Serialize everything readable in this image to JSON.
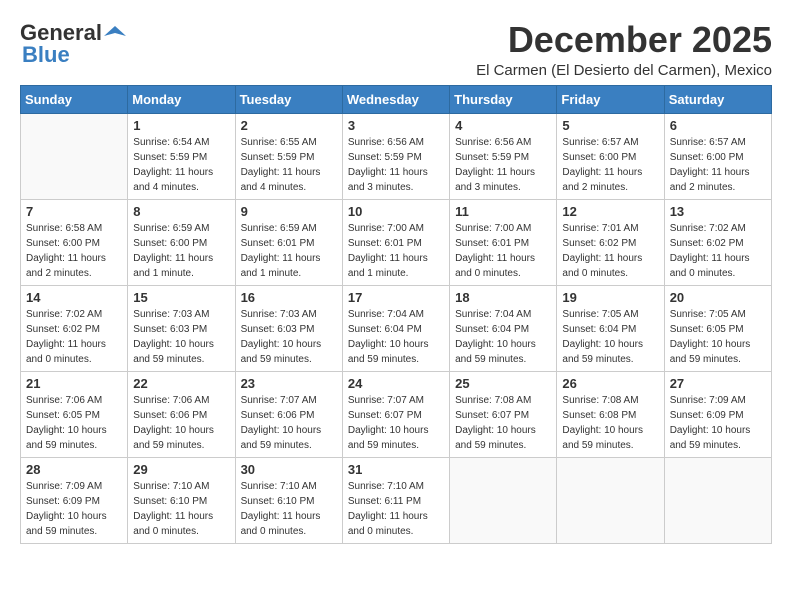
{
  "logo": {
    "general": "General",
    "blue": "Blue"
  },
  "title": {
    "month_year": "December 2025",
    "location": "El Carmen (El Desierto del Carmen), Mexico"
  },
  "headers": [
    "Sunday",
    "Monday",
    "Tuesday",
    "Wednesday",
    "Thursday",
    "Friday",
    "Saturday"
  ],
  "weeks": [
    [
      {
        "day": "",
        "info": ""
      },
      {
        "day": "1",
        "info": "Sunrise: 6:54 AM\nSunset: 5:59 PM\nDaylight: 11 hours\nand 4 minutes."
      },
      {
        "day": "2",
        "info": "Sunrise: 6:55 AM\nSunset: 5:59 PM\nDaylight: 11 hours\nand 4 minutes."
      },
      {
        "day": "3",
        "info": "Sunrise: 6:56 AM\nSunset: 5:59 PM\nDaylight: 11 hours\nand 3 minutes."
      },
      {
        "day": "4",
        "info": "Sunrise: 6:56 AM\nSunset: 5:59 PM\nDaylight: 11 hours\nand 3 minutes."
      },
      {
        "day": "5",
        "info": "Sunrise: 6:57 AM\nSunset: 6:00 PM\nDaylight: 11 hours\nand 2 minutes."
      },
      {
        "day": "6",
        "info": "Sunrise: 6:57 AM\nSunset: 6:00 PM\nDaylight: 11 hours\nand 2 minutes."
      }
    ],
    [
      {
        "day": "7",
        "info": "Sunrise: 6:58 AM\nSunset: 6:00 PM\nDaylight: 11 hours\nand 2 minutes."
      },
      {
        "day": "8",
        "info": "Sunrise: 6:59 AM\nSunset: 6:00 PM\nDaylight: 11 hours\nand 1 minute."
      },
      {
        "day": "9",
        "info": "Sunrise: 6:59 AM\nSunset: 6:01 PM\nDaylight: 11 hours\nand 1 minute."
      },
      {
        "day": "10",
        "info": "Sunrise: 7:00 AM\nSunset: 6:01 PM\nDaylight: 11 hours\nand 1 minute."
      },
      {
        "day": "11",
        "info": "Sunrise: 7:00 AM\nSunset: 6:01 PM\nDaylight: 11 hours\nand 0 minutes."
      },
      {
        "day": "12",
        "info": "Sunrise: 7:01 AM\nSunset: 6:02 PM\nDaylight: 11 hours\nand 0 minutes."
      },
      {
        "day": "13",
        "info": "Sunrise: 7:02 AM\nSunset: 6:02 PM\nDaylight: 11 hours\nand 0 minutes."
      }
    ],
    [
      {
        "day": "14",
        "info": "Sunrise: 7:02 AM\nSunset: 6:02 PM\nDaylight: 11 hours\nand 0 minutes."
      },
      {
        "day": "15",
        "info": "Sunrise: 7:03 AM\nSunset: 6:03 PM\nDaylight: 10 hours\nand 59 minutes."
      },
      {
        "day": "16",
        "info": "Sunrise: 7:03 AM\nSunset: 6:03 PM\nDaylight: 10 hours\nand 59 minutes."
      },
      {
        "day": "17",
        "info": "Sunrise: 7:04 AM\nSunset: 6:04 PM\nDaylight: 10 hours\nand 59 minutes."
      },
      {
        "day": "18",
        "info": "Sunrise: 7:04 AM\nSunset: 6:04 PM\nDaylight: 10 hours\nand 59 minutes."
      },
      {
        "day": "19",
        "info": "Sunrise: 7:05 AM\nSunset: 6:04 PM\nDaylight: 10 hours\nand 59 minutes."
      },
      {
        "day": "20",
        "info": "Sunrise: 7:05 AM\nSunset: 6:05 PM\nDaylight: 10 hours\nand 59 minutes."
      }
    ],
    [
      {
        "day": "21",
        "info": "Sunrise: 7:06 AM\nSunset: 6:05 PM\nDaylight: 10 hours\nand 59 minutes."
      },
      {
        "day": "22",
        "info": "Sunrise: 7:06 AM\nSunset: 6:06 PM\nDaylight: 10 hours\nand 59 minutes."
      },
      {
        "day": "23",
        "info": "Sunrise: 7:07 AM\nSunset: 6:06 PM\nDaylight: 10 hours\nand 59 minutes."
      },
      {
        "day": "24",
        "info": "Sunrise: 7:07 AM\nSunset: 6:07 PM\nDaylight: 10 hours\nand 59 minutes."
      },
      {
        "day": "25",
        "info": "Sunrise: 7:08 AM\nSunset: 6:07 PM\nDaylight: 10 hours\nand 59 minutes."
      },
      {
        "day": "26",
        "info": "Sunrise: 7:08 AM\nSunset: 6:08 PM\nDaylight: 10 hours\nand 59 minutes."
      },
      {
        "day": "27",
        "info": "Sunrise: 7:09 AM\nSunset: 6:09 PM\nDaylight: 10 hours\nand 59 minutes."
      }
    ],
    [
      {
        "day": "28",
        "info": "Sunrise: 7:09 AM\nSunset: 6:09 PM\nDaylight: 10 hours\nand 59 minutes."
      },
      {
        "day": "29",
        "info": "Sunrise: 7:10 AM\nSunset: 6:10 PM\nDaylight: 11 hours\nand 0 minutes."
      },
      {
        "day": "30",
        "info": "Sunrise: 7:10 AM\nSunset: 6:10 PM\nDaylight: 11 hours\nand 0 minutes."
      },
      {
        "day": "31",
        "info": "Sunrise: 7:10 AM\nSunset: 6:11 PM\nDaylight: 11 hours\nand 0 minutes."
      },
      {
        "day": "",
        "info": ""
      },
      {
        "day": "",
        "info": ""
      },
      {
        "day": "",
        "info": ""
      }
    ]
  ]
}
